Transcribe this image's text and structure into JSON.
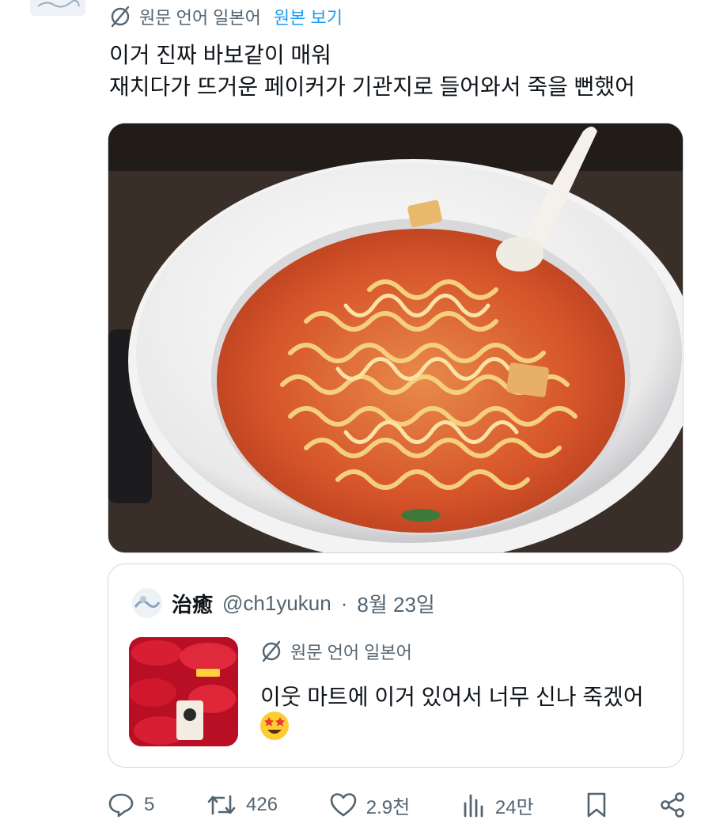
{
  "translation": {
    "source_label": "원문 언어 일본어",
    "show_original_label": "원본 보기"
  },
  "tweet": {
    "line1": "이거 진짜 바보같이 매워",
    "line2": "재치다가 뜨거운 페이커가 기관지로 들어와서 죽을 뻔했어"
  },
  "quote": {
    "display_name": "治癒",
    "handle": "@ch1yukun",
    "separator": "·",
    "date": "8월 23일",
    "translation_label": "원문 언어 일본어",
    "text": "이웃 마트에 이거 있어서 너무 신나 죽겠어"
  },
  "actions": {
    "replies": "5",
    "retweets": "426",
    "likes": "2.9천",
    "views": "24만"
  },
  "colors": {
    "accent": "#1d9bf0",
    "secondary_text": "#536471",
    "border": "#cfd9de"
  },
  "icons": [
    "translate-icon",
    "reply-icon",
    "retweet-icon",
    "like-icon",
    "views-icon",
    "bookmark-icon",
    "share-icon",
    "star-struck-emoji"
  ]
}
